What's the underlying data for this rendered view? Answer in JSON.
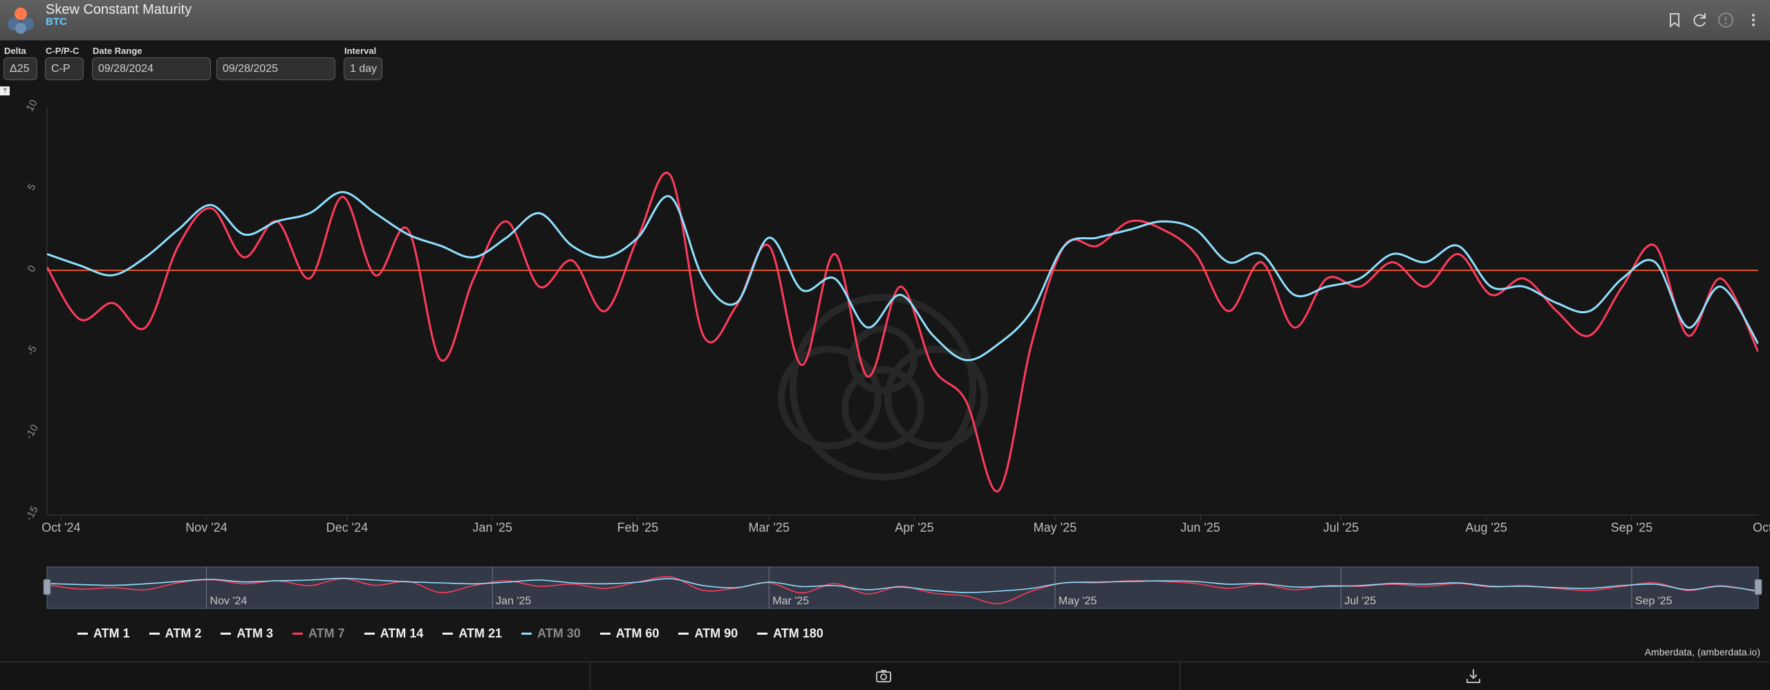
{
  "header": {
    "title": "Skew Constant Maturity",
    "subtitle": "BTC",
    "icons": [
      "bookmark-icon",
      "refresh-icon",
      "info-icon",
      "more-vertical-icon"
    ]
  },
  "controls": {
    "delta": {
      "label": "Delta",
      "value": "Δ25"
    },
    "cpc": {
      "label": "C-P/P-C",
      "value": "C-P"
    },
    "date_range": {
      "label": "Date Range",
      "start": "09/28/2024",
      "end": "09/28/2025"
    },
    "interval": {
      "label": "Interval",
      "value": "1 day"
    }
  },
  "badge": "?",
  "chart_data": {
    "type": "line",
    "title": "",
    "xlabel": "",
    "ylabel": "",
    "ylim": [
      -15,
      10
    ],
    "yticks": [
      "10",
      "5",
      "0",
      "-5",
      "-10",
      "-15"
    ],
    "xlim": [
      "2024-09-28",
      "2025-09-28"
    ],
    "xticks": [
      "Oct '24",
      "Nov '24",
      "Dec '24",
      "Jan '25",
      "Feb '25",
      "Mar '25",
      "Apr '25",
      "May '25",
      "Jun '25",
      "Jul '25",
      "Aug '25",
      "Sep '25",
      "Oct '25"
    ],
    "zero_line_color": "#e2561f",
    "grid": false,
    "legend_position": "bottom",
    "x": [
      "2024-09-28",
      "2024-10-05",
      "2024-10-12",
      "2024-10-19",
      "2024-10-26",
      "2024-11-02",
      "2024-11-09",
      "2024-11-16",
      "2024-11-23",
      "2024-11-30",
      "2024-12-07",
      "2024-12-14",
      "2024-12-21",
      "2024-12-28",
      "2025-01-04",
      "2025-01-11",
      "2025-01-18",
      "2025-01-25",
      "2025-02-01",
      "2025-02-08",
      "2025-02-15",
      "2025-02-22",
      "2025-03-01",
      "2025-03-08",
      "2025-03-15",
      "2025-03-22",
      "2025-03-29",
      "2025-04-05",
      "2025-04-12",
      "2025-04-19",
      "2025-04-26",
      "2025-05-03",
      "2025-05-10",
      "2025-05-17",
      "2025-05-24",
      "2025-05-31",
      "2025-06-07",
      "2025-06-14",
      "2025-06-21",
      "2025-06-28",
      "2025-07-05",
      "2025-07-12",
      "2025-07-19",
      "2025-07-26",
      "2025-08-02",
      "2025-08-09",
      "2025-08-16",
      "2025-08-23",
      "2025-08-30",
      "2025-09-06",
      "2025-09-13",
      "2025-09-20",
      "2025-09-28"
    ],
    "series": [
      {
        "name": "ATM 7",
        "color": "#ff3b5c",
        "visible": true,
        "values": [
          0.2,
          -3.0,
          -2.0,
          -3.5,
          1.5,
          3.8,
          0.8,
          3.0,
          -0.5,
          4.5,
          -0.3,
          2.5,
          -5.5,
          -0.5,
          3.0,
          -1.0,
          0.6,
          -2.5,
          2.0,
          5.8,
          -4.0,
          -2.2,
          1.5,
          -5.8,
          1.0,
          -6.5,
          -1.0,
          -6.0,
          -8.0,
          -13.5,
          -4.5,
          1.5,
          1.5,
          3.0,
          2.5,
          1.0,
          -2.5,
          0.5,
          -3.5,
          -0.5,
          -1.0,
          0.5,
          -1.0,
          1.0,
          -1.5,
          -0.5,
          -2.5,
          -4.0,
          -1.0,
          1.5,
          -4.0,
          -0.5,
          -5.0
        ]
      },
      {
        "name": "ATM 30",
        "color": "#8fe0ff",
        "visible": true,
        "values": [
          1.0,
          0.3,
          -0.3,
          0.8,
          2.5,
          4.0,
          2.2,
          3.0,
          3.5,
          4.8,
          3.5,
          2.2,
          1.5,
          0.8,
          2.0,
          3.5,
          1.5,
          0.8,
          2.0,
          4.5,
          -0.5,
          -2.0,
          2.0,
          -1.2,
          -0.5,
          -3.5,
          -1.5,
          -4.0,
          -5.5,
          -4.5,
          -2.5,
          1.5,
          2.0,
          2.5,
          3.0,
          2.5,
          0.5,
          1.0,
          -1.5,
          -1.0,
          -0.5,
          1.0,
          0.5,
          1.5,
          -1.0,
          -1.0,
          -2.0,
          -2.5,
          -0.5,
          0.5,
          -3.5,
          -1.0,
          -4.5
        ]
      },
      {
        "name": "ATM 1",
        "visible": false
      },
      {
        "name": "ATM 2",
        "visible": false
      },
      {
        "name": "ATM 3",
        "visible": false
      },
      {
        "name": "ATM 14",
        "visible": false
      },
      {
        "name": "ATM 21",
        "visible": false
      },
      {
        "name": "ATM 60",
        "visible": false
      },
      {
        "name": "ATM 90",
        "visible": false
      },
      {
        "name": "ATM 180",
        "visible": false
      }
    ],
    "navigator": {
      "labels": [
        "Nov '24",
        "Jan '25",
        "Mar '25",
        "May '25",
        "Jul '25",
        "Sep '25"
      ]
    }
  },
  "legend": {
    "items": [
      {
        "label": "ATM 1",
        "active": true
      },
      {
        "label": "ATM 2",
        "active": true
      },
      {
        "label": "ATM 3",
        "active": true
      },
      {
        "label": "ATM 7",
        "active": false,
        "color": "#ff3b5c"
      },
      {
        "label": "ATM 14",
        "active": true
      },
      {
        "label": "ATM 21",
        "active": true
      },
      {
        "label": "ATM 30",
        "active": false,
        "color": "#8fe0ff"
      },
      {
        "label": "ATM 60",
        "active": true
      },
      {
        "label": "ATM 90",
        "active": true
      },
      {
        "label": "ATM 180",
        "active": true
      }
    ]
  },
  "credit": "Amberdata, (amberdata.io)",
  "footer": {
    "icons": [
      "camera-icon",
      "download-icon"
    ]
  },
  "colors": {
    "header_bg": "#575757",
    "accent": "#69c8ff",
    "chart_bg": "#161616"
  }
}
